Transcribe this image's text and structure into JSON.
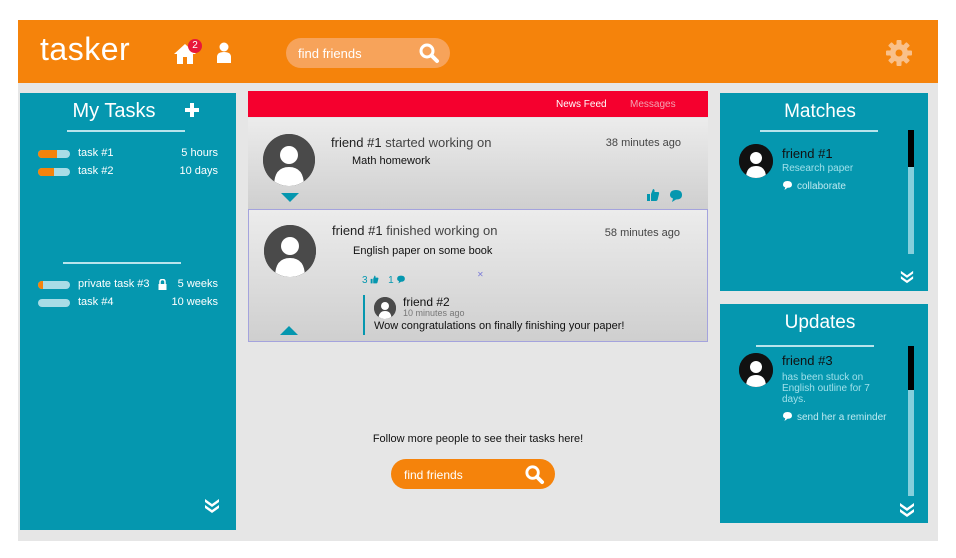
{
  "colors": {
    "orange": "#f5830b",
    "teal": "#0597af",
    "red": "#f5002e",
    "badge": "#e8173a"
  },
  "header": {
    "logo": "tasker",
    "notification_count": "2",
    "search_placeholder": "find friends"
  },
  "tasks_panel": {
    "title": "My Tasks",
    "tasks": [
      {
        "name": "task #1",
        "time": "5 hours",
        "progress": 0.6
      },
      {
        "name": "task #2",
        "time": "10 days",
        "progress": 0.5
      }
    ],
    "private_tasks": [
      {
        "name": "private task #3",
        "time": "5 weeks",
        "progress": 0.15,
        "locked": true
      },
      {
        "name": "task #4",
        "time": "10 weeks",
        "progress": 0.0
      }
    ]
  },
  "feed": {
    "tabs": [
      {
        "label": "News Feed",
        "active": true
      },
      {
        "label": "Messages",
        "active": false
      }
    ],
    "posts": [
      {
        "friend": "friend #1",
        "action": "started working on",
        "task": "Math homework",
        "ago": "38 minutes ago"
      },
      {
        "friend": "friend #1",
        "action": "finished working on",
        "task": "English paper on some book",
        "ago": "58 minutes ago",
        "likes": "3",
        "comments": "1",
        "comment": {
          "name": "friend #2",
          "ago": "10 minutes ago",
          "text": "Wow congratulations on finally finishing your paper!"
        }
      }
    ],
    "follow_text": "Follow more people to see their tasks here!",
    "search_placeholder": "find friends"
  },
  "matches": {
    "title": "Matches",
    "item": {
      "name": "friend #1",
      "sub": "Research paper",
      "action": "collaborate"
    }
  },
  "updates": {
    "title": "Updates",
    "item": {
      "name": "friend #3",
      "sub_lines": [
        "has been stuck on",
        "English outline for 7",
        "days."
      ],
      "action": "send her a reminder"
    }
  }
}
